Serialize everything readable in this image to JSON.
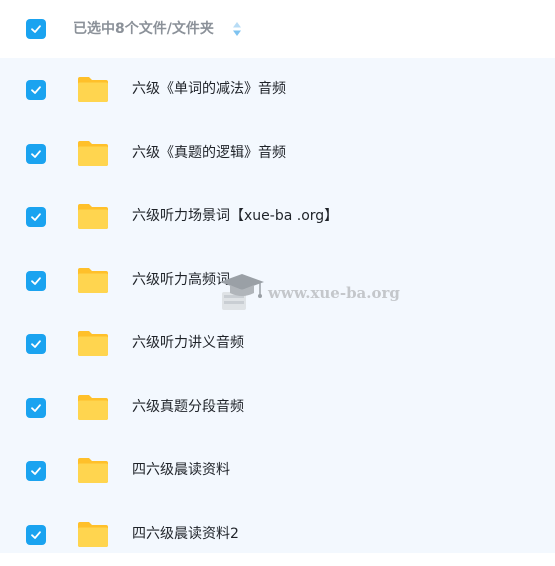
{
  "header": {
    "title": "已选中8个文件/文件夹"
  },
  "colors": {
    "checkbox": "#1aa3f0",
    "list_background": "#f3f8fe",
    "folder": "#ffcb30"
  },
  "files": [
    {
      "name": "六级《单词的减法》音频",
      "type": "folder",
      "checked": true
    },
    {
      "name": "六级《真题的逻辑》音频",
      "type": "folder",
      "checked": true
    },
    {
      "name": "六级听力场景词【xue-ba .org】",
      "type": "folder",
      "checked": true
    },
    {
      "name": "六级听力高频词",
      "type": "folder",
      "checked": true
    },
    {
      "name": "六级听力讲义音频",
      "type": "folder",
      "checked": true
    },
    {
      "name": "六级真题分段音频",
      "type": "folder",
      "checked": true
    },
    {
      "name": "四六级晨读资料",
      "type": "folder",
      "checked": true
    },
    {
      "name": "四六级晨读资料2",
      "type": "folder",
      "checked": true
    }
  ],
  "watermark": {
    "text": "www.xue-ba.org"
  }
}
